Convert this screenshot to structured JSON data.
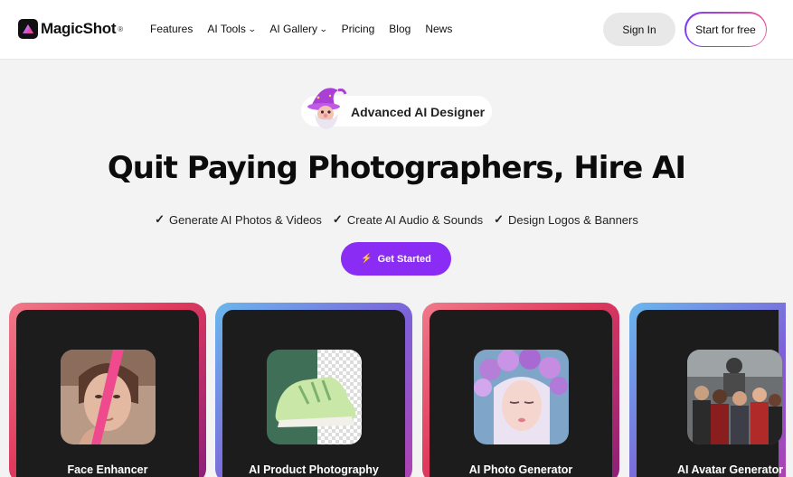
{
  "header": {
    "logo_text": "MagicShot",
    "logo_mark": "®",
    "nav": [
      {
        "label": "Features",
        "dropdown": false
      },
      {
        "label": "AI Tools",
        "dropdown": true
      },
      {
        "label": "AI Gallery",
        "dropdown": true
      },
      {
        "label": "Pricing",
        "dropdown": false
      },
      {
        "label": "Blog",
        "dropdown": false
      },
      {
        "label": "News",
        "dropdown": false
      }
    ],
    "chevron": "⌄",
    "signin_label": "Sign In",
    "start_label": "Start for free"
  },
  "hero": {
    "badge_icon": "wizard-icon",
    "badge_text": "Advanced AI Designer",
    "headline": "Quit Paying Photographers, Hire AI",
    "check_glyph": "✓",
    "features": [
      "Generate AI Photos & Videos",
      "Create AI Audio & Sounds",
      "Design Logos & Banners"
    ],
    "cta_icon": "⚡",
    "cta_label": "Get Started"
  },
  "cards": [
    {
      "title": "Face Enhancer"
    },
    {
      "title": "AI Product Photography"
    },
    {
      "title": "AI Photo Generator"
    },
    {
      "title": "AI Avatar Generator"
    }
  ],
  "colors": {
    "accent": "#8b2cf5",
    "background": "#f3f3f3",
    "card_dark": "#1c1c1c"
  }
}
